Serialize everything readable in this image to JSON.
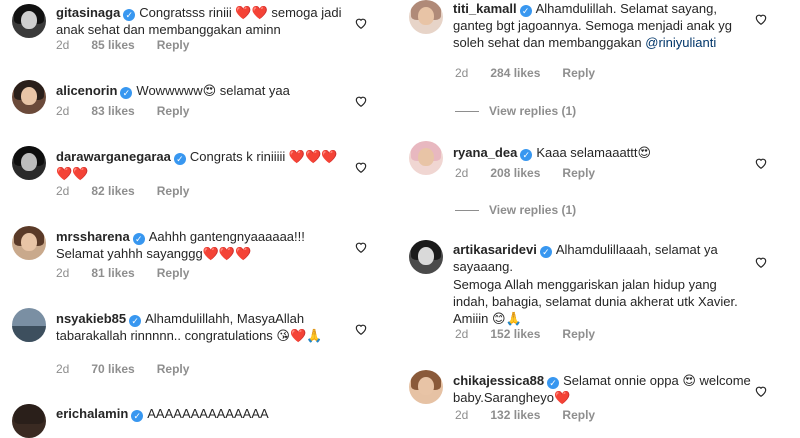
{
  "left_comments": [
    {
      "username": "gitasinaga",
      "text": "Congratsss riniii ❤️❤️ semoga jadi anak sehat dan membanggakan aminn",
      "time": "2d",
      "likes": "85 likes",
      "reply": "Reply"
    },
    {
      "username": "alicenorin",
      "text": "Wowwwww😍 selamat yaa",
      "time": "2d",
      "likes": "83 likes",
      "reply": "Reply"
    },
    {
      "username": "darawarganegaraa",
      "text": "Congrats k riniiiii ❤️❤️❤️❤️❤️",
      "time": "2d",
      "likes": "82 likes",
      "reply": "Reply"
    },
    {
      "username": "mrssharena",
      "text": "Aahhh gantengnyaaaaaa!!! Selamat yahhh sayanggg❤️❤️❤️",
      "time": "2d",
      "likes": "81 likes",
      "reply": "Reply"
    },
    {
      "username": "nsyakieb85",
      "text": "Alhamdulillahh, MasyaAllah tabarakallah rinnnnn.. congratulations 😘❤️🙏",
      "time": "2d",
      "likes": "70 likes",
      "reply": "Reply"
    },
    {
      "username": "erichalamin",
      "text": "AAAAAAAAAAAAAA",
      "time": "",
      "likes": "",
      "reply": ""
    }
  ],
  "right_comments": [
    {
      "username": "titi_kamall",
      "text": "Alhamdulillah. Selamat sayang, ganteg bgt jagoannya. Semoga menjadi anak yg soleh sehat dan membanggakan",
      "mention": "@riniyulianti",
      "time": "2d",
      "likes": "284 likes",
      "reply": "Reply"
    },
    {
      "username": "ryana_dea",
      "text": "Kaaa selamaaattt😍",
      "mention": "",
      "time": "2d",
      "likes": "208 likes",
      "reply": "Reply"
    },
    {
      "username": "artikasaridevi",
      "text": "Alhamdulillaaah, selamat ya sayaaang.",
      "text2": "Semoga Allah menggariskan jalan hidup yang indah, bahagia, selamat dunia akherat utk Xavier. Amiiin 😊🙏",
      "mention": "",
      "time": "2d",
      "likes": "152 likes",
      "reply": "Reply"
    },
    {
      "username": "chikajessica88",
      "text": "Selamat onnie oppa 😍 welcome baby.Sarangheyo❤️",
      "mention": "",
      "time": "2d",
      "likes": "132 likes",
      "reply": "Reply"
    }
  ],
  "view_replies": [
    "View replies (1)",
    "View replies (1)"
  ],
  "colors": {
    "verified": "#3897f0",
    "meta": "#8e8e8e",
    "text": "#262626",
    "mention": "#003569"
  }
}
